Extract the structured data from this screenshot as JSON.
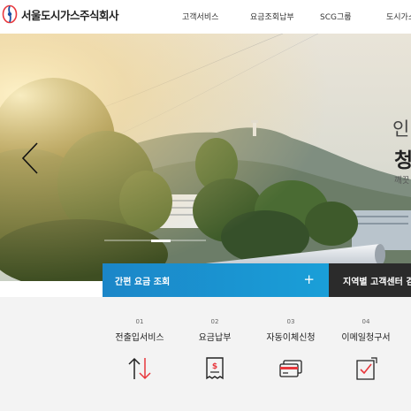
{
  "header": {
    "logo_text": "서울도시가스주식회사",
    "nav": [
      {
        "label": "고객서비스"
      },
      {
        "label": "요금조회납부"
      },
      {
        "label": "SCG그룹"
      },
      {
        "label": "도시가스"
      }
    ]
  },
  "hero": {
    "line1": "인",
    "line2": "청",
    "line3": "깨끗"
  },
  "quick": {
    "left_label": "간편 요금 조회",
    "left_icon": "plus-icon",
    "right_label": "지역별 고객센터 검색"
  },
  "services": [
    {
      "num": "01",
      "title": "전출입서비스",
      "icon": "transfer-arrows-icon"
    },
    {
      "num": "02",
      "title": "요금납부",
      "icon": "bill-icon"
    },
    {
      "num": "03",
      "title": "자동이체신청",
      "icon": "card-icon"
    },
    {
      "num": "04",
      "title": "이메일청구서",
      "icon": "email-bill-icon"
    }
  ],
  "colors": {
    "accent_red": "#e8383d",
    "quick_blue": "#1a9fd8",
    "quick_dark": "#2b2b2b"
  }
}
